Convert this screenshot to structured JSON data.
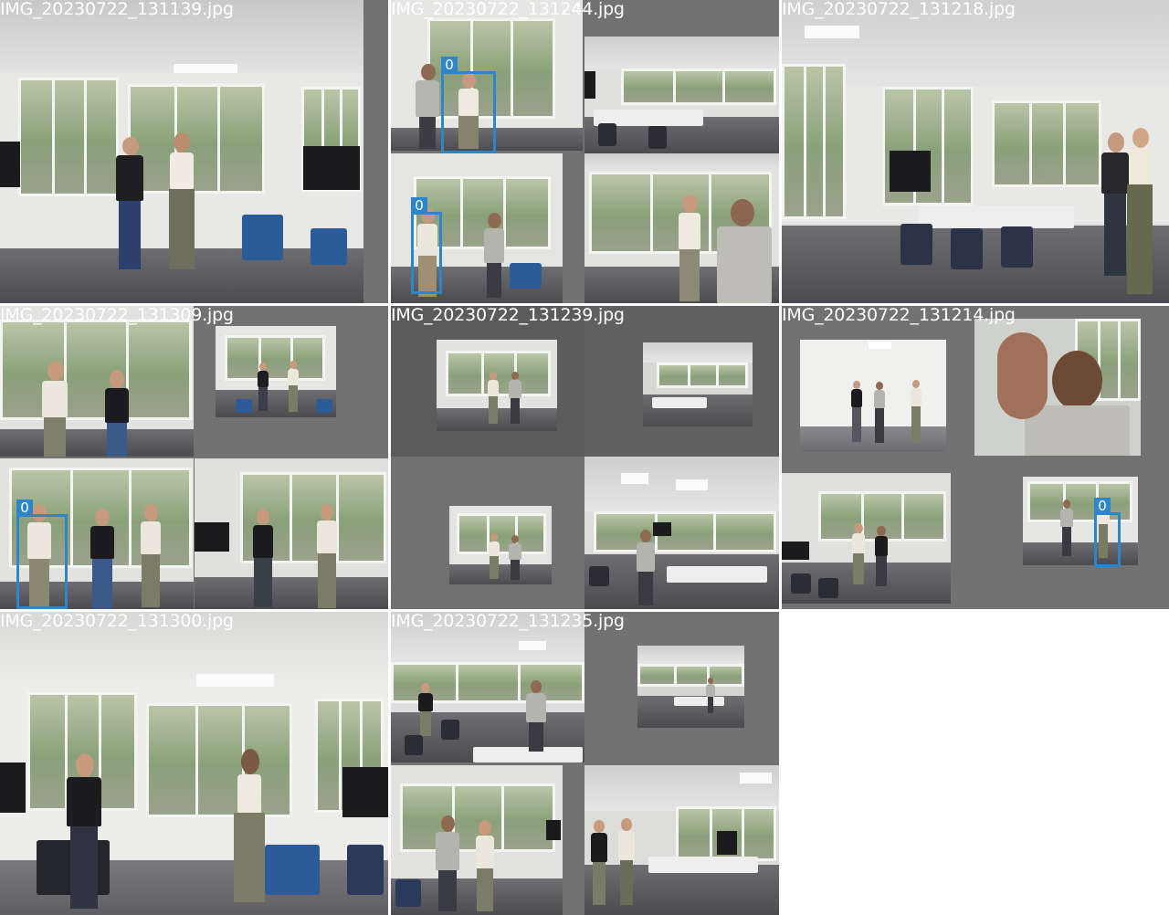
{
  "tiles": [
    {
      "label": "IMG_20230722_131139.jpg"
    },
    {
      "label": "IMG_20230722_131244.jpg",
      "boxes": [
        {
          "tag": "0"
        },
        {
          "tag": "0"
        }
      ]
    },
    {
      "label": "IMG_20230722_131218.jpg"
    },
    {
      "label": "IMG_20230722_131309.jpg",
      "boxes": [
        {
          "tag": "0"
        }
      ]
    },
    {
      "label": "IMG_20230722_131239.jpg"
    },
    {
      "label": "IMG_20230722_131214.jpg",
      "boxes": [
        {
          "tag": "0"
        }
      ]
    },
    {
      "label": "IMG_20230722_131300.jpg"
    },
    {
      "label": "IMG_20230722_131235.jpg"
    }
  ],
  "colors": {
    "background": "#ffffff",
    "tile_fill": "#727272",
    "bbox": "#2e86c9",
    "label_text": "#ffffff"
  }
}
